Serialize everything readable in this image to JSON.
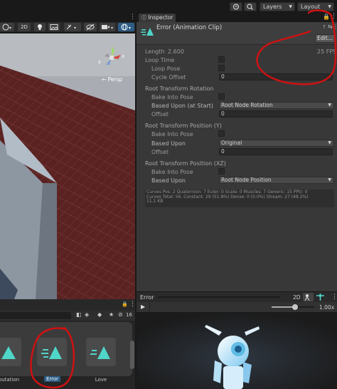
{
  "toolbar": {
    "layers_label": "Layers",
    "layout_label": "Layout"
  },
  "scene": {
    "toggle_2d": "2D",
    "persp_label": "← Persp",
    "gizmo_x": "x",
    "gizmo_z": "z"
  },
  "inspector": {
    "tab_label": "Inspector",
    "asset_title": "Error (Animation Clip)",
    "edit_button": "Edit...",
    "length_label": "Length",
    "length_value": "2.600",
    "fps_value": "25 FPS",
    "loop_time_label": "Loop Time",
    "loop_pose_label": "Loop Pose",
    "cycle_offset_label": "Cycle Offset",
    "cycle_offset_value": "0",
    "rtr_section": "Root Transform Rotation",
    "bake_into_pose_label": "Bake Into Pose",
    "based_upon_at_start_label": "Based Upon (at Start)",
    "rtr_based_value": "Root Node Rotation",
    "offset_label": "Offset",
    "rtr_offset_value": "0",
    "rtpy_section": "Root Transform Position (Y)",
    "based_upon_label": "Based Upon",
    "rtpy_based_value": "Original",
    "rtpy_offset_value": "0",
    "rtpxz_section": "Root Transform Position (XZ)",
    "rtpxz_based_value": "Root Node Position",
    "info_line1": "Curves Pos: 2 Quaternion: 7 Euler: 0 Scale: 0 Muscles: 7 Generic: 15 PPtr: 0",
    "info_line2": "Curves Total: 56, Constant: 29 (51.8%) Dense: 0 (0.0%) Stream: 27 (48.2%)",
    "info_line3": "11.1 KB"
  },
  "preview": {
    "title": "Error",
    "toggle_2d": "2D",
    "speed_value": "1.00x",
    "speed_fraction": 0.55
  },
  "project": {
    "visibility_count": "16",
    "assets": [
      {
        "label": "Reputation"
      },
      {
        "label": "Error"
      },
      {
        "label": "Love"
      }
    ]
  },
  "colors": {
    "accent_teal": "#4fd6c9",
    "annotation_red": "#cf1111",
    "selection_blue": "#2c5d87"
  }
}
